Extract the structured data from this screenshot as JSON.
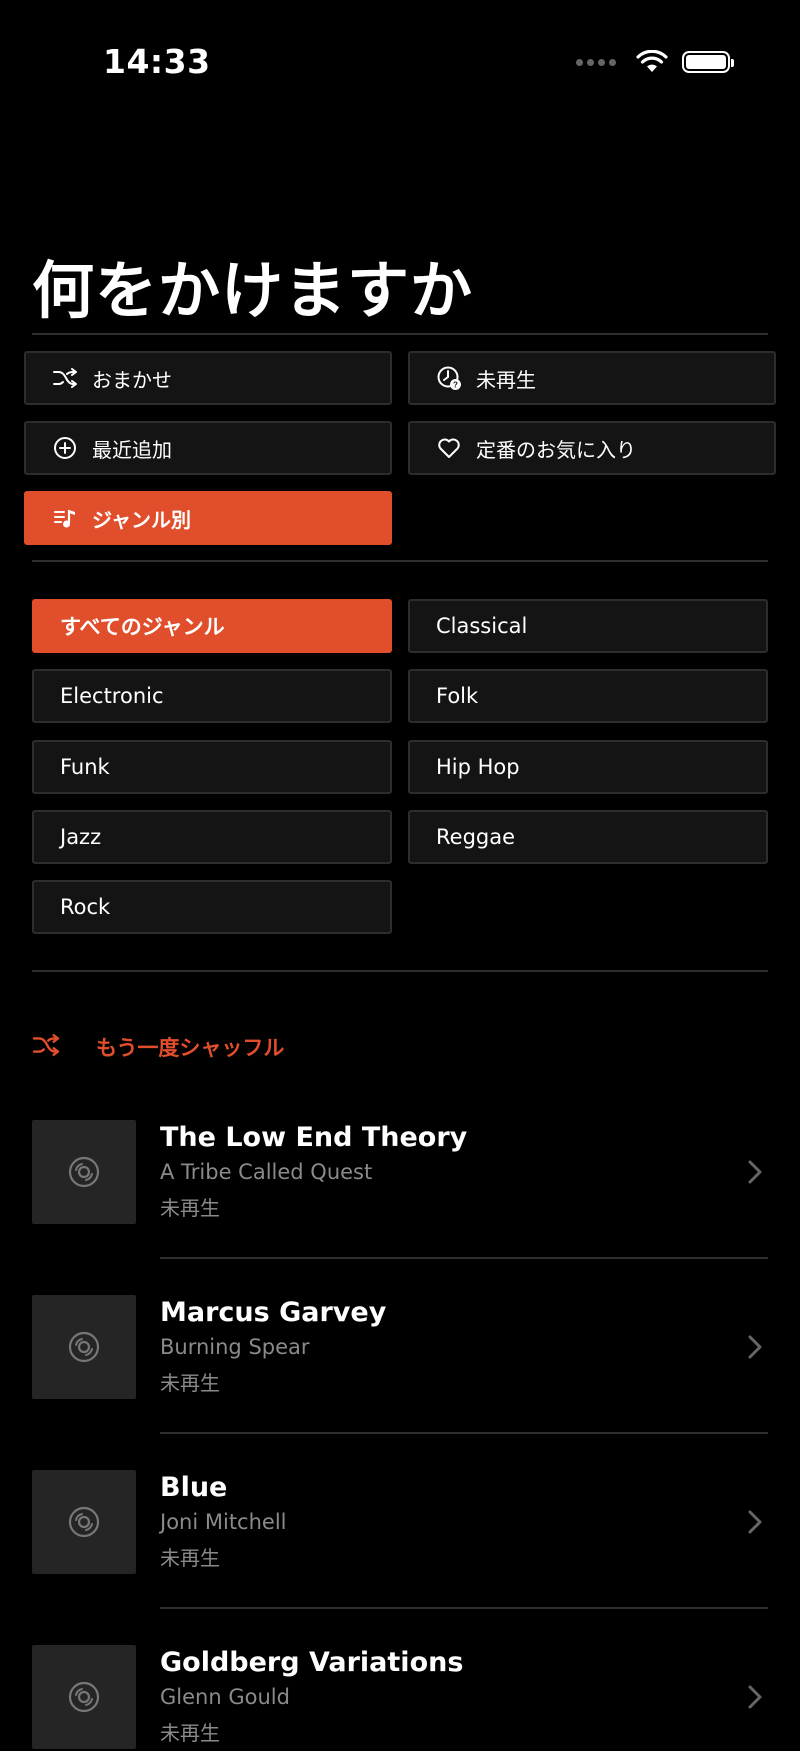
{
  "status_bar": {
    "time": "14:33"
  },
  "header": {
    "title": "何をかけますか"
  },
  "modes": {
    "shuffle_label": "おまかせ",
    "unplayed_label": "未再生",
    "recent_label": "最近追加",
    "favorites_label": "定番のお気に入り",
    "genre_label": "ジャンル別",
    "active": "ジャンル別"
  },
  "genres": {
    "items": [
      "すべてのジャンル",
      "Classical",
      "Electronic",
      "Folk",
      "Funk",
      "Hip Hop",
      "Jazz",
      "Reggae",
      "Rock"
    ],
    "active": "すべてのジャンル"
  },
  "reshuffle": {
    "label": "もう一度シャッフル"
  },
  "albums": [
    {
      "title": "The Low End Theory",
      "artist": "A Tribe Called Quest",
      "status": "未再生"
    },
    {
      "title": "Marcus Garvey",
      "artist": "Burning Spear",
      "status": "未再生"
    },
    {
      "title": "Blue",
      "artist": "Joni Mitchell",
      "status": "未再生"
    },
    {
      "title": "Goldberg Variations",
      "artist": "Glenn Gould",
      "status": "未再生"
    }
  ],
  "colors": {
    "accent": "#e04e2c",
    "background": "#000000",
    "button_bg": "#141414",
    "thumb_bg": "#252525"
  },
  "icons": [
    "shuffle-icon",
    "clock-question-icon",
    "plus-circle-icon",
    "heart-icon",
    "genre-list-icon",
    "disc-icon",
    "chevron-right-icon",
    "wifi-icon",
    "battery-icon"
  ]
}
